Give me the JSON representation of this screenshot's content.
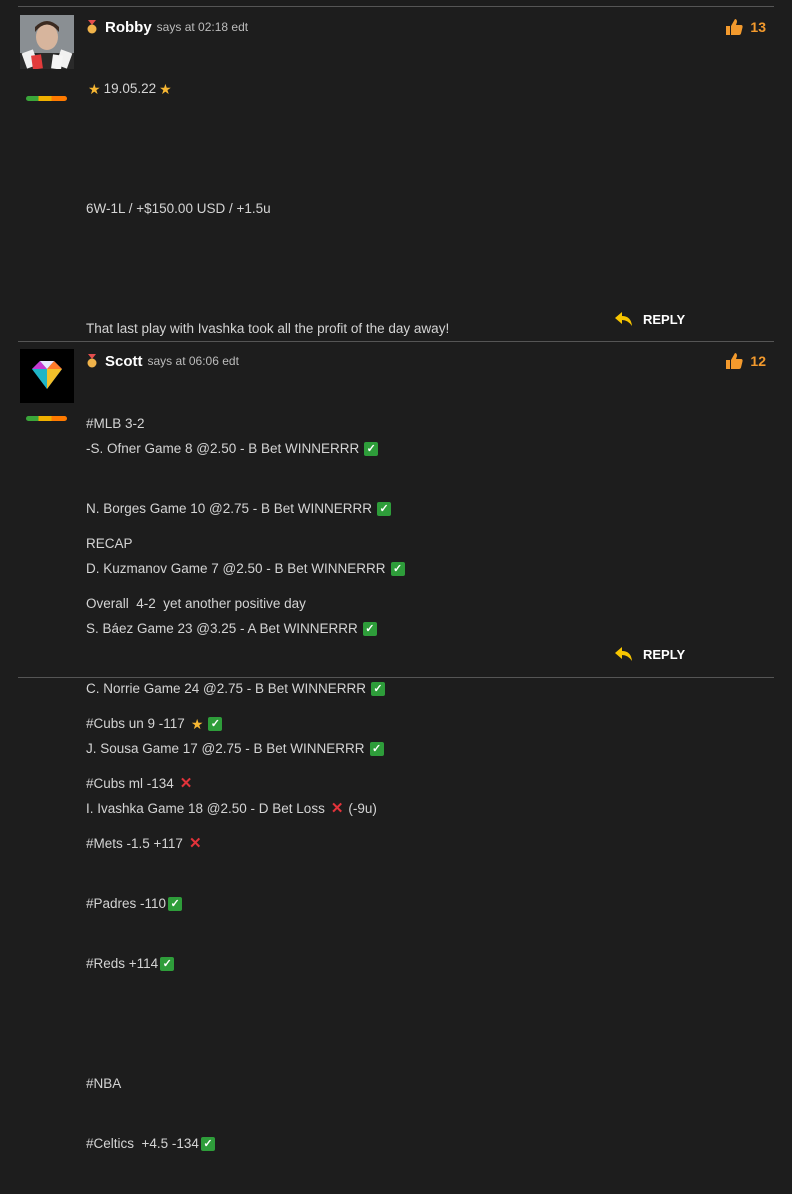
{
  "comments": [
    {
      "author": "Robby",
      "says": "says",
      "time": "at 02:18 edt",
      "likes": "13",
      "subtitle": "19.05.22",
      "lines": [
        "6W-1L / +$150.00 USD / +1.5u",
        "",
        "That last play with Ivashka took all the profit of the day away!",
        "",
        "-S. Ofner Game 8 @2.50 - B Bet WINNERRR",
        "N. Borges Game 10 @2.75 - B Bet WINNERRR",
        "D. Kuzmanov Game 7 @2.50 - B Bet WINNERRR",
        "S. Báez Game 23 @3.25 - A Bet WINNERRR",
        "C. Norrie Game 24 @2.75 - B Bet WINNERRR",
        "J. Sousa Game 17 @2.75 - B Bet WINNERRR",
        "I. Ivashka Game 18 @2.50 - D Bet Loss",
        "(-9u)"
      ],
      "reply_label": "REPLY",
      "avatar_icon": "avatar-photo-man-with-cards"
    },
    {
      "author": "Scott",
      "says": "says",
      "time": "at 06:06 edt",
      "likes": "12",
      "lines": [
        "#MLB 3-2",
        "",
        "RECAP",
        "Overall  4-2  yet another positive day",
        "",
        "#Cubs un 9 -117",
        "#Cubs ml -134",
        "#Mets -1.5 +117",
        "#Padres -110",
        "#Reds +114",
        "",
        "#NBA",
        "#Celtics  +4.5 -134"
      ],
      "reply_label": "REPLY",
      "avatar_icon": "avatar-diamond"
    }
  ],
  "icons": {
    "like": "thumbs-up-icon",
    "reply": "reply-arrow-icon",
    "win": "check-mark-icon",
    "loss": "cross-mark-icon",
    "star": "star-icon",
    "rank": "medal-icon"
  },
  "colors": {
    "accent": "#f39a2d",
    "win": "#2e9d3a",
    "loss": "#e2333a",
    "star": "#f7b733"
  }
}
